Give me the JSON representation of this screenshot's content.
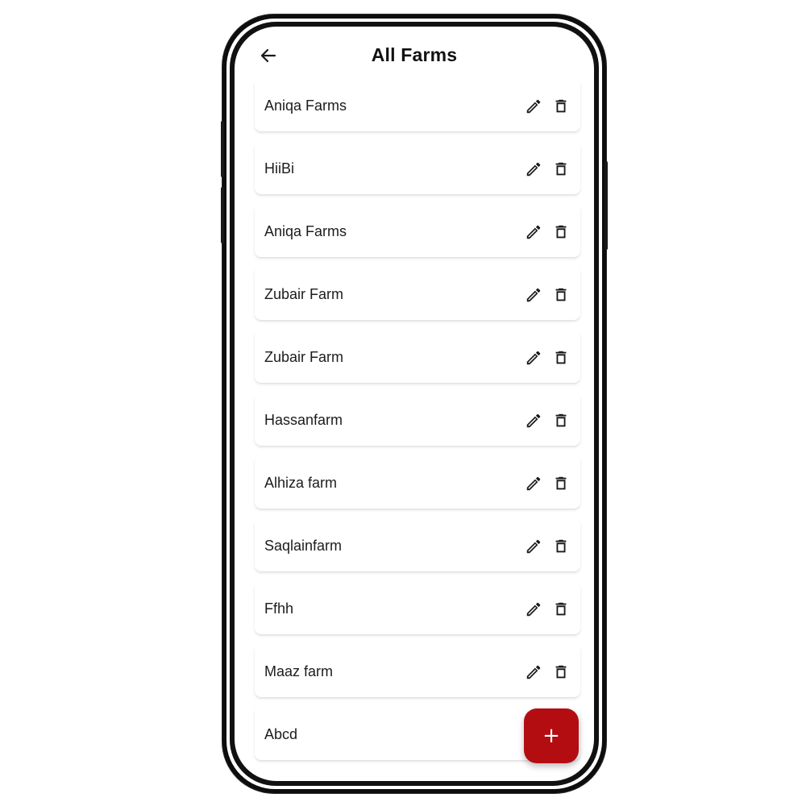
{
  "header": {
    "title": "All Farms",
    "back_icon": "arrow-left-icon"
  },
  "farms": [
    {
      "name": "Aniqa Farms"
    },
    {
      "name": "HiiBi"
    },
    {
      "name": "Aniqa Farms"
    },
    {
      "name": "Zubair Farm"
    },
    {
      "name": "Zubair Farm"
    },
    {
      "name": "Hassanfarm"
    },
    {
      "name": "Alhiza farm"
    },
    {
      "name": "Saqlainfarm"
    },
    {
      "name": "Ffhh"
    },
    {
      "name": "Maaz farm"
    },
    {
      "name": "Abcd"
    }
  ],
  "row_icons": {
    "edit": "pencil-icon",
    "delete": "trash-icon"
  },
  "fab": {
    "label": "+",
    "icon": "plus-icon"
  },
  "colors": {
    "accent": "#b30d12",
    "text": "#1c1c1c",
    "icon": "#1a1a1a"
  }
}
